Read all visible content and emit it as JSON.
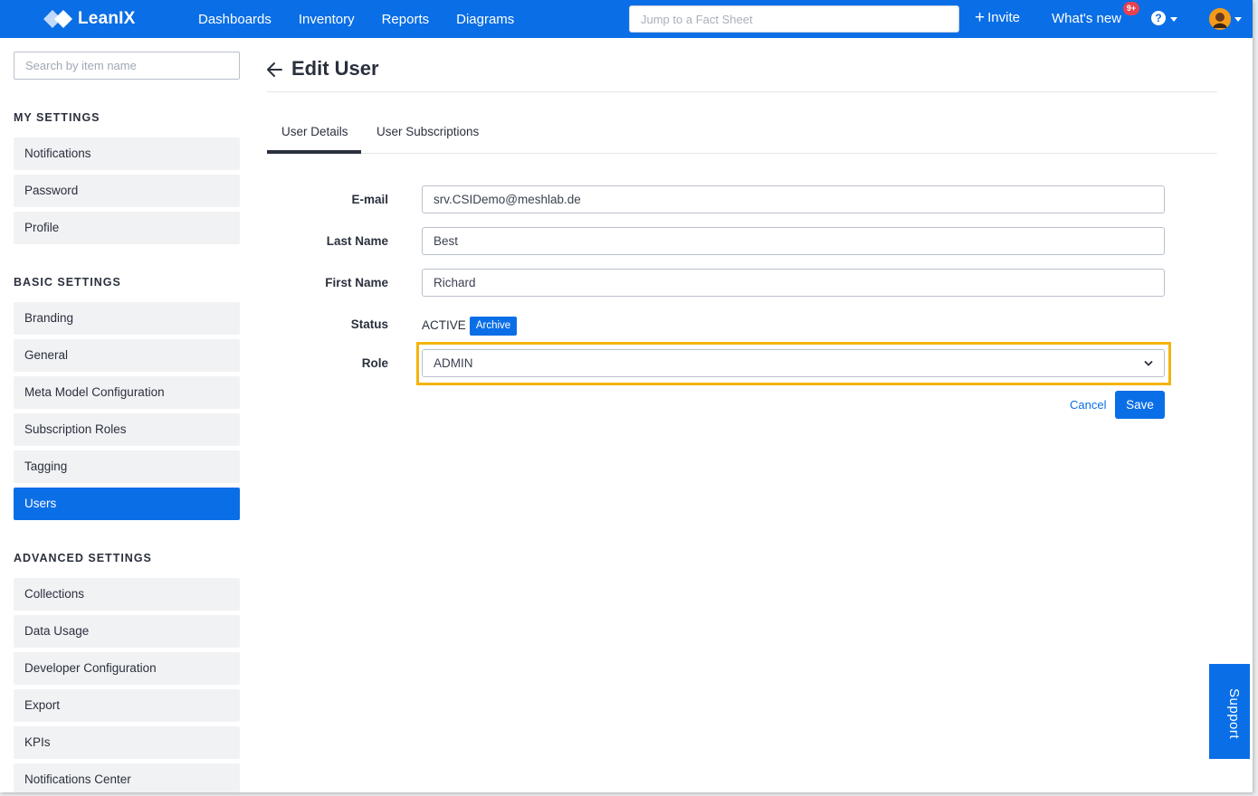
{
  "topbar": {
    "logo_text": "LeanIX",
    "nav": [
      "Dashboards",
      "Inventory",
      "Reports",
      "Diagrams"
    ],
    "jump_placeholder": "Jump to a Fact Sheet",
    "invite_label": "Invite",
    "whats_new_label": "What's new",
    "whats_new_badge": "9+",
    "help_glyph": "?"
  },
  "sidebar": {
    "search_placeholder": "Search by item name",
    "sections": [
      {
        "title": "MY SETTINGS",
        "items": [
          "Notifications",
          "Password",
          "Profile"
        ]
      },
      {
        "title": "BASIC SETTINGS",
        "items": [
          "Branding",
          "General",
          "Meta Model Configuration",
          "Subscription Roles",
          "Tagging",
          "Users"
        ]
      },
      {
        "title": "ADVANCED SETTINGS",
        "items": [
          "Collections",
          "Data Usage",
          "Developer Configuration",
          "Export",
          "KPIs",
          "Notifications Center"
        ]
      }
    ],
    "active_item": "Users"
  },
  "main": {
    "title": "Edit User",
    "tabs": [
      "User Details",
      "User Subscriptions"
    ],
    "active_tab": "User Details",
    "form": {
      "email_label": "E-mail",
      "email_value": "srv.CSIDemo@meshlab.de",
      "last_name_label": "Last Name",
      "last_name_value": "Best",
      "first_name_label": "First Name",
      "first_name_value": "Richard",
      "status_label": "Status",
      "status_value": "ACTIVE",
      "archive_label": "Archive",
      "role_label": "Role",
      "role_value": "ADMIN"
    },
    "cancel_label": "Cancel",
    "save_label": "Save"
  },
  "support_label": "Support",
  "colors": {
    "brand": "#0a6ee6",
    "highlight": "#f3b40b",
    "badge": "#e8414f"
  },
  "icons": [
    "leanix-logo-icon",
    "plus-icon",
    "help-icon",
    "chevron-down-icon",
    "avatar",
    "back-arrow-icon"
  ]
}
